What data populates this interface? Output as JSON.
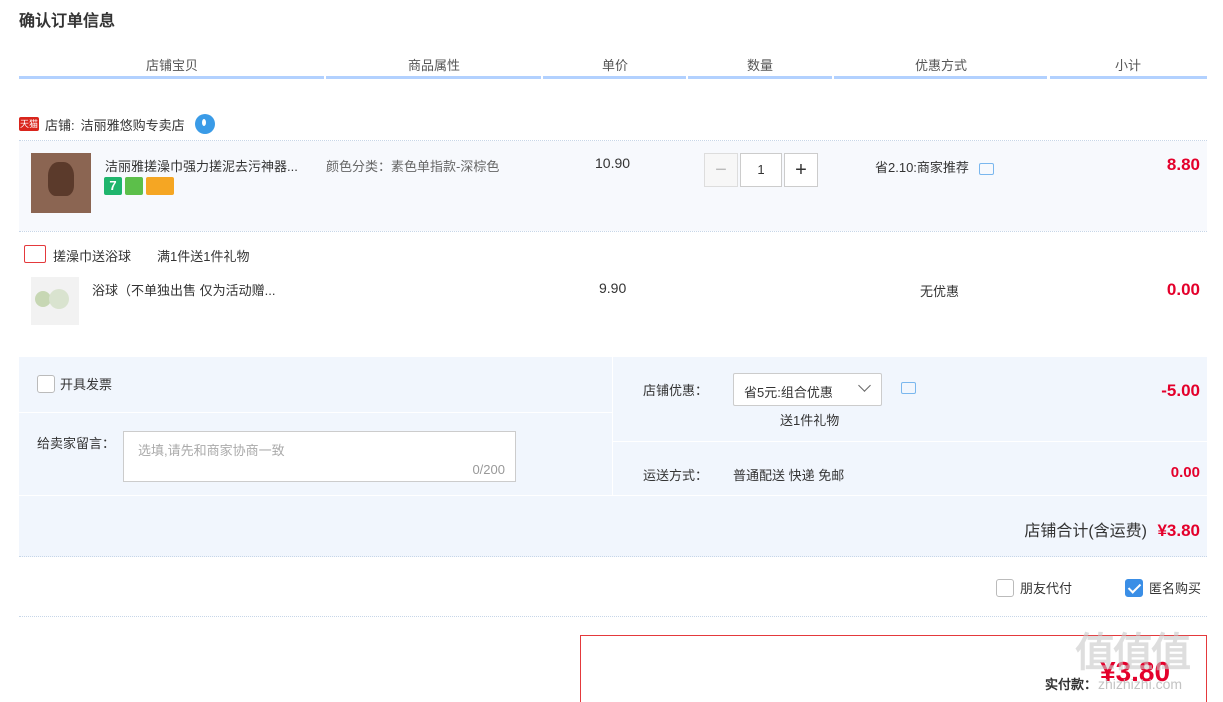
{
  "page": {
    "title": "确认订单信息"
  },
  "columns": [
    "店铺宝贝",
    "商品属性",
    "单价",
    "数量",
    "优惠方式",
    "小计"
  ],
  "shop": {
    "badge": "天猫",
    "label": "店铺:",
    "name": "洁丽雅悠购专卖店"
  },
  "item1": {
    "name": "洁丽雅搓澡巾强力搓泥去污神器...",
    "attr": "颜色分类：素色单指款-深棕色",
    "price": "10.90",
    "quantity": "1",
    "promo": "省2.10:商家推荐",
    "subtotal": "8.80"
  },
  "gift_promo": {
    "name": "搓澡巾送浴球",
    "rule": "满1件送1件礼物"
  },
  "item2": {
    "name": "浴球（不单独出售 仅为活动赠...",
    "price": "9.90",
    "promo": "无优惠",
    "subtotal": "0.00"
  },
  "invoice": {
    "label": "开具发票"
  },
  "message": {
    "label": "给卖家留言：",
    "placeholder": "选填,请先和商家协商一致",
    "counter": "0/200"
  },
  "shop_discount": {
    "label": "店铺优惠：",
    "selected": "省5元:组合优惠",
    "note": "送1件礼物",
    "amount": "-5.00"
  },
  "shipping": {
    "label": "运送方式：",
    "value": "普通配送 快递 免邮",
    "amount": "0.00"
  },
  "shop_total": {
    "label": "店铺合计(含运费)",
    "amount": "¥3.80"
  },
  "options": {
    "friend_pay": "朋友代付",
    "anonymous": "匿名购买"
  },
  "payment": {
    "label": "实付款：",
    "amount": "¥3.80"
  },
  "watermark": {
    "brand": "值值值",
    "url": "zhizhizhi.com"
  },
  "colors": {
    "price_red": "#e4002b",
    "accent_blue": "#3a8ee6",
    "tmall_red": "#d9251c"
  }
}
